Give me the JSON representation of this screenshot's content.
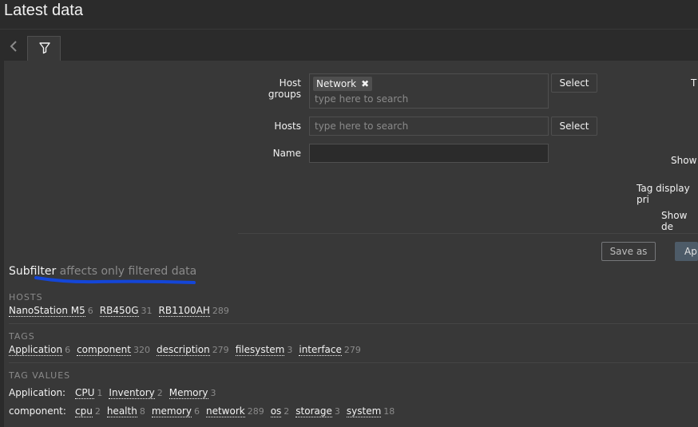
{
  "header": {
    "title": "Latest data"
  },
  "filter_tab": {
    "icon": "filter-icon"
  },
  "filter": {
    "host_groups_label": "Host groups",
    "host_groups_chip": "Network",
    "host_groups_placeholder": "type here to search",
    "hosts_label": "Hosts",
    "hosts_placeholder": "type here to search",
    "name_label": "Name",
    "name_value": "",
    "select_label": "Select",
    "right_labels": [
      "T",
      "Show",
      "Tag display pri",
      "Show de"
    ],
    "save_as_label": "Save as",
    "apply_label": "App"
  },
  "subfilter": {
    "title": "Subfilter",
    "hint": "affects only filtered data",
    "hosts_title": "HOSTS",
    "hosts": [
      {
        "name": "NanoStation M5",
        "count": "6"
      },
      {
        "name": "RB450G",
        "count": "31"
      },
      {
        "name": "RB1100AH",
        "count": "289"
      }
    ],
    "tags_title": "TAGS",
    "tags": [
      {
        "name": "Application",
        "count": "6"
      },
      {
        "name": "component",
        "count": "320"
      },
      {
        "name": "description",
        "count": "279"
      },
      {
        "name": "filesystem",
        "count": "3"
      },
      {
        "name": "interface",
        "count": "279"
      }
    ],
    "tag_values_title": "TAG VALUES",
    "tag_values": {
      "application_label": "Application:",
      "application": [
        {
          "name": "CPU",
          "count": "1"
        },
        {
          "name": "Inventory",
          "count": "2"
        },
        {
          "name": "Memory",
          "count": "3"
        }
      ],
      "component_label": "component:",
      "component": [
        {
          "name": "cpu",
          "count": "2"
        },
        {
          "name": "health",
          "count": "8"
        },
        {
          "name": "memory",
          "count": "6"
        },
        {
          "name": "network",
          "count": "289"
        },
        {
          "name": "os",
          "count": "2"
        },
        {
          "name": "storage",
          "count": "3"
        },
        {
          "name": "system",
          "count": "18"
        }
      ]
    }
  },
  "colors": {
    "background": "#2b2b2b",
    "panel": "#383838",
    "underline": "#1446d8"
  }
}
